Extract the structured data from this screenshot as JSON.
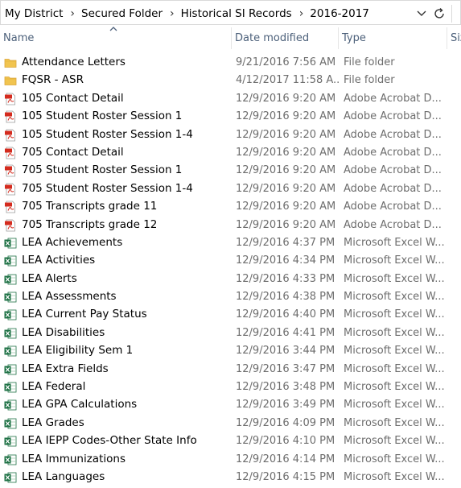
{
  "breadcrumbs": [
    "My District",
    "Secured Folder",
    "Historical SI Records",
    "2016-2017"
  ],
  "columns": {
    "name": "Name",
    "date": "Date modified",
    "type": "Type",
    "size": "Siz"
  },
  "files": [
    {
      "name": "Attendance Letters",
      "date": "9/21/2016 7:56 AM",
      "type": "File folder",
      "icon": "folder-icon"
    },
    {
      "name": "FQSR - ASR",
      "date": "4/12/2017 11:58 A...",
      "type": "File folder",
      "icon": "folder-icon"
    },
    {
      "name": "105 Contact Detail",
      "date": "12/9/2016 9:20 AM",
      "type": "Adobe Acrobat D...",
      "icon": "pdf-icon"
    },
    {
      "name": "105 Student Roster Session 1",
      "date": "12/9/2016 9:20 AM",
      "type": "Adobe Acrobat D...",
      "icon": "pdf-icon"
    },
    {
      "name": "105 Student Roster Session 1-4",
      "date": "12/9/2016 9:20 AM",
      "type": "Adobe Acrobat D...",
      "icon": "pdf-icon"
    },
    {
      "name": "705 Contact Detail",
      "date": "12/9/2016 9:20 AM",
      "type": "Adobe Acrobat D...",
      "icon": "pdf-icon"
    },
    {
      "name": "705 Student Roster Session 1",
      "date": "12/9/2016 9:20 AM",
      "type": "Adobe Acrobat D...",
      "icon": "pdf-icon"
    },
    {
      "name": "705 Student Roster Session 1-4",
      "date": "12/9/2016 9:20 AM",
      "type": "Adobe Acrobat D...",
      "icon": "pdf-icon"
    },
    {
      "name": "705 Transcripts grade 11",
      "date": "12/9/2016 9:20 AM",
      "type": "Adobe Acrobat D...",
      "icon": "pdf-icon"
    },
    {
      "name": "705 Transcripts grade 12",
      "date": "12/9/2016 9:20 AM",
      "type": "Adobe Acrobat D...",
      "icon": "pdf-icon"
    },
    {
      "name": "LEA Achievements",
      "date": "12/9/2016 4:37 PM",
      "type": "Microsoft Excel W...",
      "icon": "excel-icon"
    },
    {
      "name": "LEA Activities",
      "date": "12/9/2016 4:34 PM",
      "type": "Microsoft Excel W...",
      "icon": "excel-icon"
    },
    {
      "name": "LEA Alerts",
      "date": "12/9/2016 4:33 PM",
      "type": "Microsoft Excel W...",
      "icon": "excel-icon"
    },
    {
      "name": "LEA Assessments",
      "date": "12/9/2016 4:38 PM",
      "type": "Microsoft Excel W...",
      "icon": "excel-icon"
    },
    {
      "name": "LEA Current Pay Status",
      "date": "12/9/2016 4:40 PM",
      "type": "Microsoft Excel W...",
      "icon": "excel-icon"
    },
    {
      "name": "LEA Disabilities",
      "date": "12/9/2016 4:41 PM",
      "type": "Microsoft Excel W...",
      "icon": "excel-icon"
    },
    {
      "name": "LEA Eligibility Sem 1",
      "date": "12/9/2016 3:44 PM",
      "type": "Microsoft Excel W...",
      "icon": "excel-icon"
    },
    {
      "name": "LEA Extra Fields",
      "date": "12/9/2016 3:47 PM",
      "type": "Microsoft Excel W...",
      "icon": "excel-icon"
    },
    {
      "name": "LEA Federal",
      "date": "12/9/2016 3:48 PM",
      "type": "Microsoft Excel W...",
      "icon": "excel-icon"
    },
    {
      "name": "LEA GPA Calculations",
      "date": "12/9/2016 3:49 PM",
      "type": "Microsoft Excel W...",
      "icon": "excel-icon"
    },
    {
      "name": "LEA Grades",
      "date": "12/9/2016 4:09 PM",
      "type": "Microsoft Excel W...",
      "icon": "excel-icon"
    },
    {
      "name": "LEA IEPP Codes-Other State Info",
      "date": "12/9/2016 4:10 PM",
      "type": "Microsoft Excel W...",
      "icon": "excel-icon"
    },
    {
      "name": "LEA Immunizations",
      "date": "12/9/2016 4:14 PM",
      "type": "Microsoft Excel W...",
      "icon": "excel-icon"
    },
    {
      "name": "LEA Languages",
      "date": "12/9/2016 4:15 PM",
      "type": "Microsoft Excel W...",
      "icon": "excel-icon"
    }
  ],
  "colors": {
    "folder": "#f1c44f",
    "pdf_red": "#d42b1e",
    "excel_green": "#1e7145",
    "header_text": "#4c607a",
    "secondary_text": "#6d6d6d"
  }
}
